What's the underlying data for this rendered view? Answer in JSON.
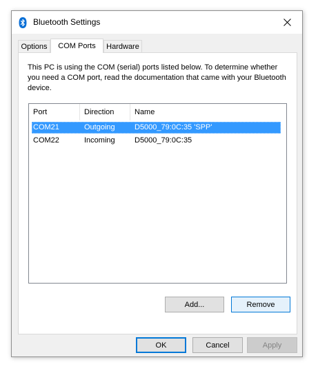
{
  "window": {
    "title": "Bluetooth Settings",
    "icon": "bluetooth-icon",
    "close_icon": "close-icon"
  },
  "tabs": [
    {
      "label": "Options",
      "active": false
    },
    {
      "label": "COM Ports",
      "active": true
    },
    {
      "label": "Hardware",
      "active": false
    }
  ],
  "com_ports": {
    "description": "This PC is using the COM (serial) ports listed below. To determine whether you need a COM port, read the documentation that came with your Bluetooth device.",
    "columns": [
      "Port",
      "Direction",
      "Name"
    ],
    "rows": [
      {
        "port": "COM21",
        "direction": "Outgoing",
        "name": "D5000_79:0C:35 'SPP'",
        "selected": true
      },
      {
        "port": "COM22",
        "direction": "Incoming",
        "name": "D5000_79:0C:35",
        "selected": false
      }
    ],
    "add_label": "Add...",
    "remove_label": "Remove"
  },
  "footer": {
    "ok_label": "OK",
    "cancel_label": "Cancel",
    "apply_label": "Apply"
  },
  "colors": {
    "selection": "#3399ff",
    "accent": "#0078d7"
  }
}
